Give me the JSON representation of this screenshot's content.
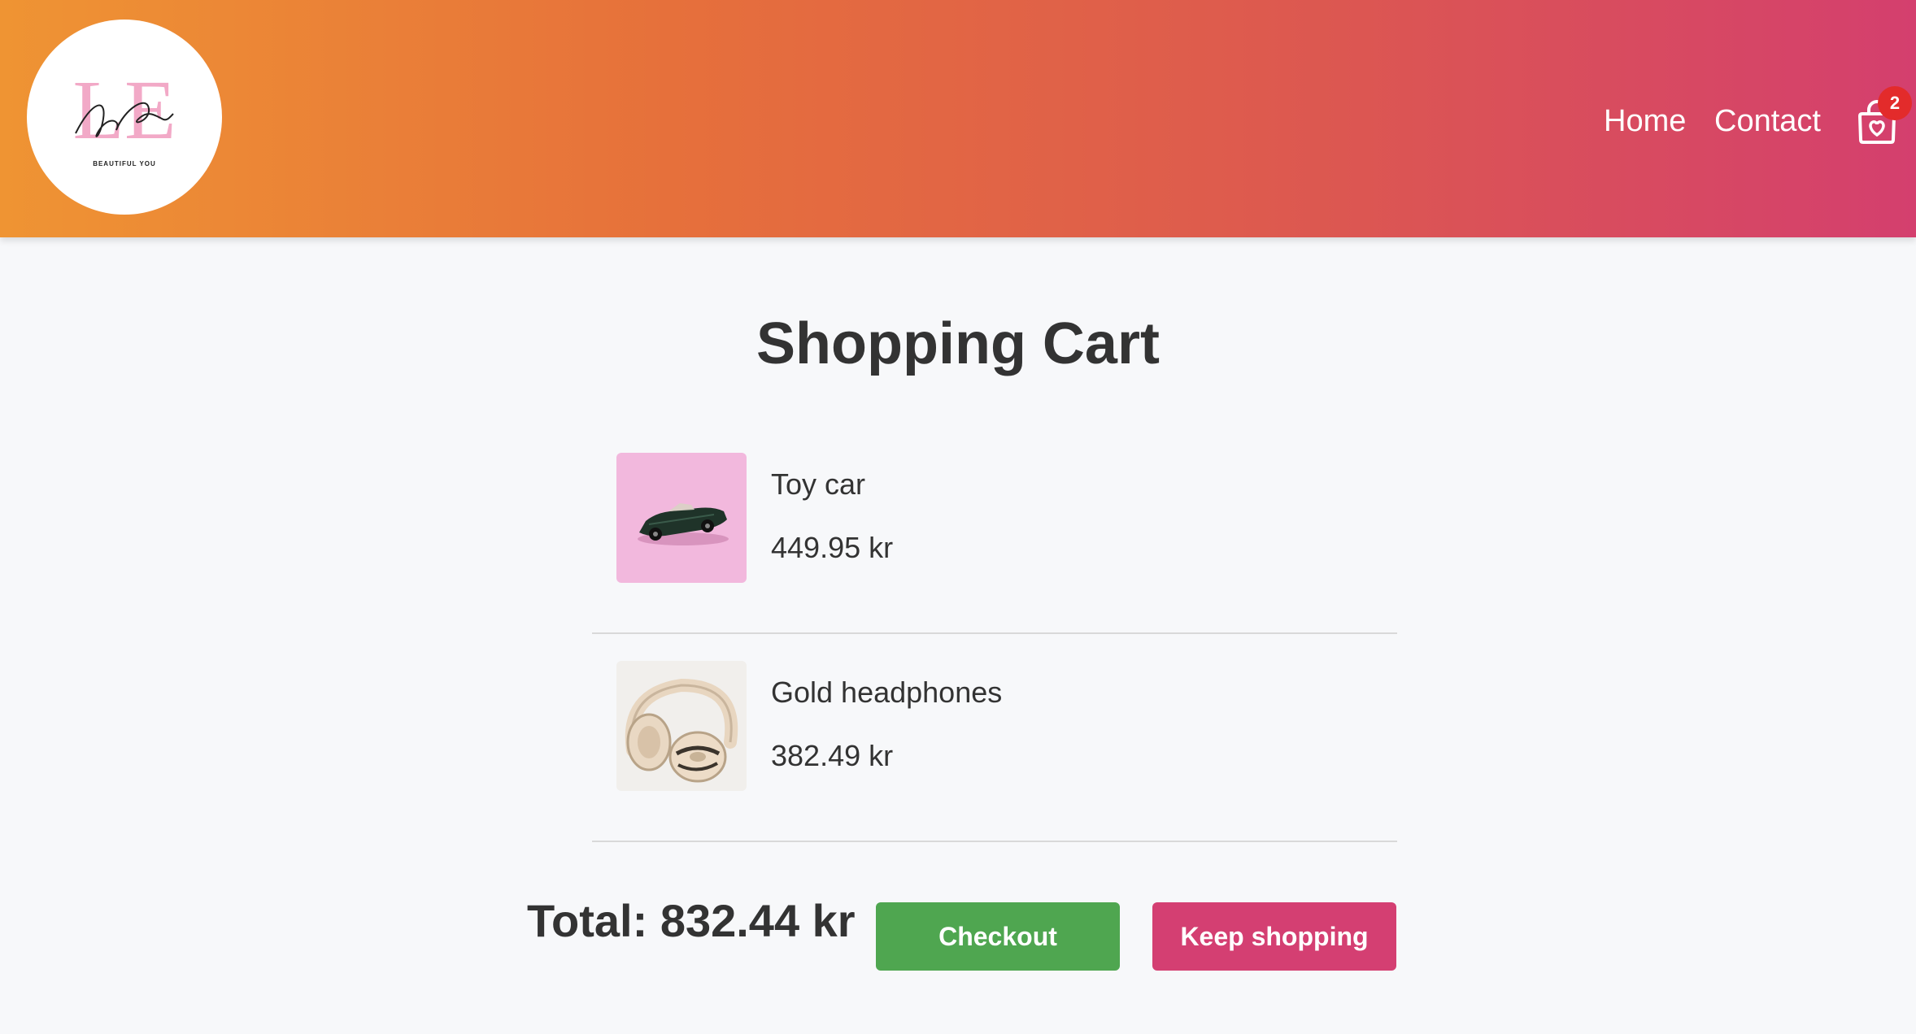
{
  "header": {
    "logo": {
      "monogram": "LE",
      "script": "Lyn Ellie",
      "tagline": "BEAUTIFUL YOU"
    },
    "nav": {
      "home": "Home",
      "contact": "Contact"
    },
    "cart_count": "2",
    "cart_icon": "shopping-bag-heart-icon",
    "colors": {
      "gradient_start": "#ef9433",
      "gradient_end": "#d43f6e"
    }
  },
  "page": {
    "title": "Shopping Cart"
  },
  "cart": {
    "items": [
      {
        "name": "Toy car",
        "price": "449.95 kr",
        "image": "toy-car-photo"
      },
      {
        "name": "Gold headphones",
        "price": "382.49 kr",
        "image": "gold-headphones-photo"
      }
    ],
    "total": "Total: 832.44 kr"
  },
  "actions": {
    "checkout": "Checkout",
    "keep_shopping": "Keep shopping",
    "colors": {
      "checkout": "#4fa650",
      "keep_shopping": "#d43f72"
    }
  }
}
